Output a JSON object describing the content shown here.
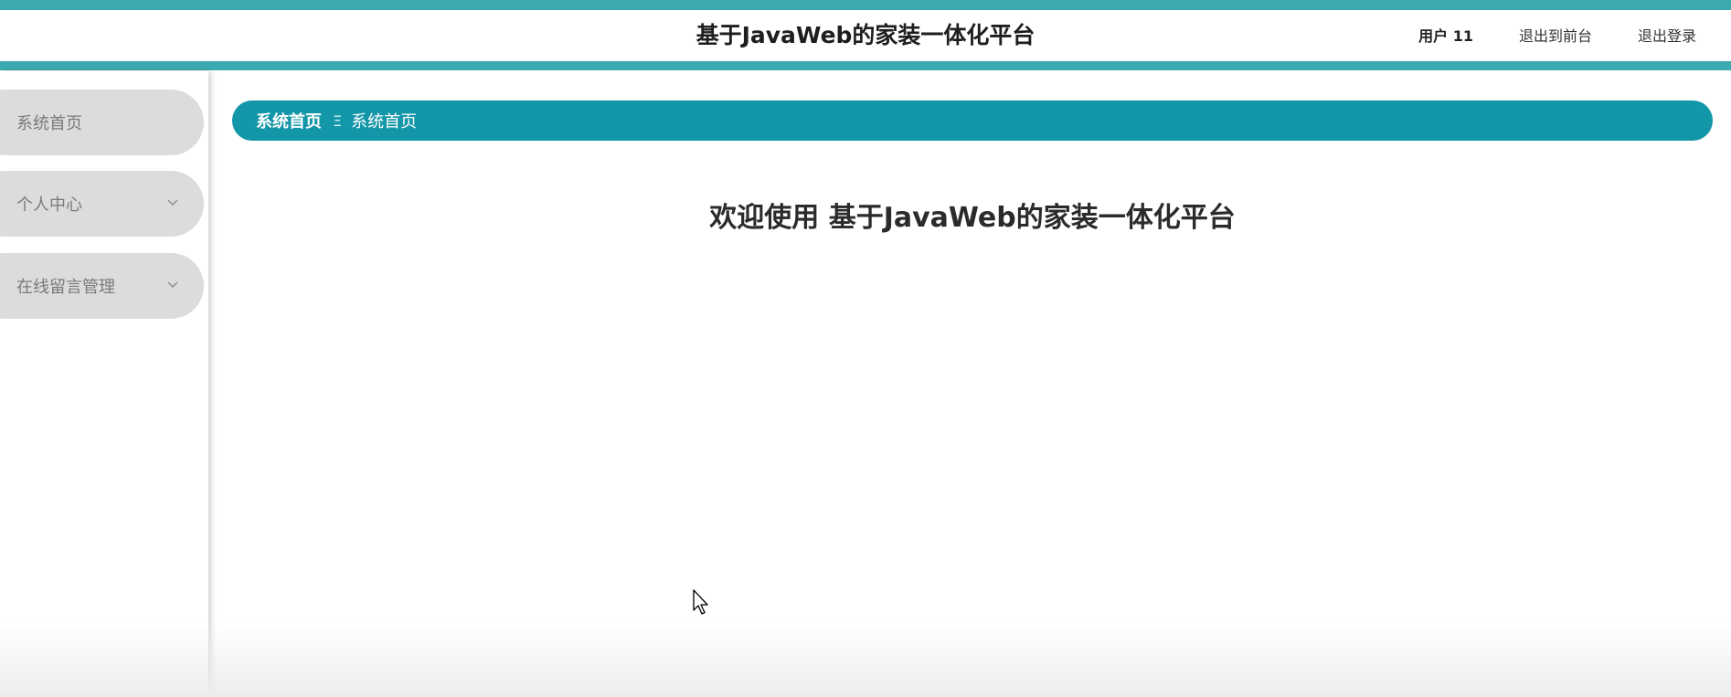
{
  "header": {
    "title": "基于JavaWeb的家装一体化平台",
    "user_label": "用户 11",
    "front_label": "退出到前台",
    "logout_label": "退出登录"
  },
  "sidebar": {
    "items": [
      {
        "label": "系统首页",
        "has_children": false
      },
      {
        "label": "个人中心",
        "has_children": true
      },
      {
        "label": "在线留言管理",
        "has_children": true
      }
    ]
  },
  "breadcrumb": {
    "home": "系统首页",
    "separator": "Ξ",
    "current": "系统首页"
  },
  "main": {
    "welcome": "欢迎使用 基于JavaWeb的家装一体化平台"
  },
  "colors": {
    "accent": "#3aaab0",
    "breadcrumb": "#1296a8",
    "menu_bg": "#dcdcdc"
  }
}
